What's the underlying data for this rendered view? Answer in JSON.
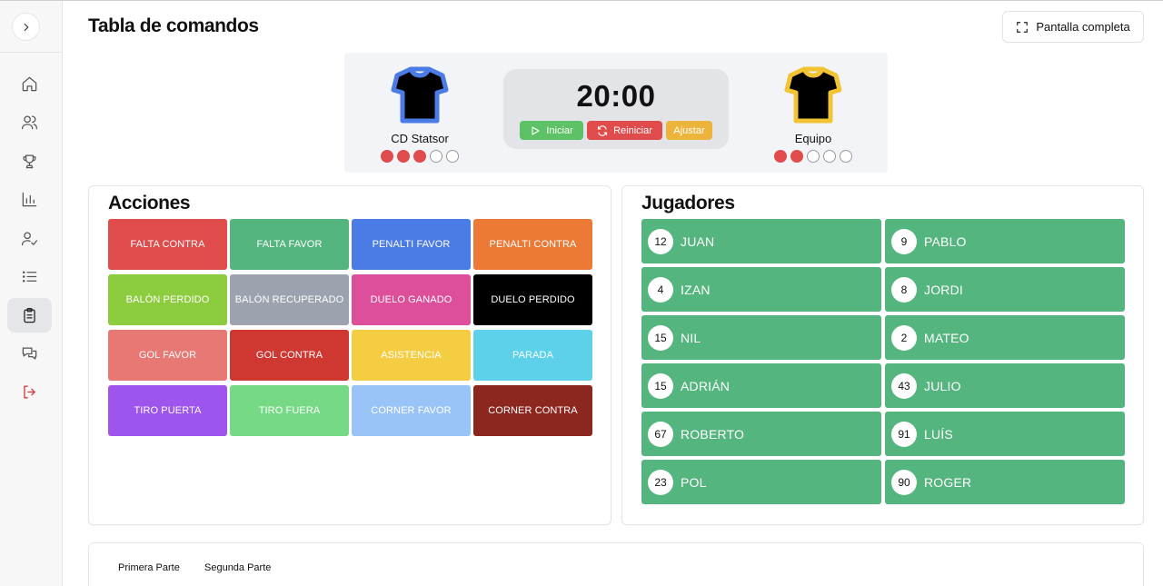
{
  "header": {
    "title": "Tabla de comandos",
    "fullscreen_label": "Pantalla completa"
  },
  "sidebar": {
    "items": [
      {
        "icon": "home-icon"
      },
      {
        "icon": "users-icon"
      },
      {
        "icon": "trophy-icon"
      },
      {
        "icon": "bar-chart-icon"
      },
      {
        "icon": "user-check-icon"
      },
      {
        "icon": "list-icon"
      },
      {
        "icon": "clipboard-icon",
        "active": true
      },
      {
        "icon": "messages-icon"
      },
      {
        "icon": "logout-icon"
      }
    ]
  },
  "scoreboard": {
    "home": {
      "name": "CD Statsor",
      "shirt_color": "#4b7be5",
      "fouls": 3,
      "foul_max": 5
    },
    "away": {
      "name": "Equipo",
      "shirt_color": "#f2c333",
      "fouls": 2,
      "foul_max": 5
    },
    "time": "20:00",
    "buttons": {
      "start": "Iniciar",
      "reset": "Reiniciar",
      "adjust": "Ajustar"
    }
  },
  "actions": {
    "title": "Acciones",
    "items": [
      {
        "label": "FALTA CONTRA",
        "color": "#e04b4b"
      },
      {
        "label": "FALTA FAVOR",
        "color": "#55b57f"
      },
      {
        "label": "PENALTI FAVOR",
        "color": "#4b7be5"
      },
      {
        "label": "PENALTI CONTRA",
        "color": "#ec7a36"
      },
      {
        "label": "BALÓN PERDIDO",
        "color": "#8dcb3f"
      },
      {
        "label": "BALÓN RECUPERADO",
        "color": "#9ca3af"
      },
      {
        "label": "DUELO GANADO",
        "color": "#dd4f9a"
      },
      {
        "label": "DUELO PERDIDO",
        "color": "#000000"
      },
      {
        "label": "GOL FAVOR",
        "color": "#e87873"
      },
      {
        "label": "GOL CONTRA",
        "color": "#cf3731"
      },
      {
        "label": "ASISTENCIA",
        "color": "#f4cd43"
      },
      {
        "label": "PARADA",
        "color": "#5dd0ea"
      },
      {
        "label": "TIRO PUERTA",
        "color": "#9d55ee"
      },
      {
        "label": "TIRO FUERA",
        "color": "#76d985"
      },
      {
        "label": "CORNER FAVOR",
        "color": "#99c4f7"
      },
      {
        "label": "CORNER CONTRA",
        "color": "#8c2720"
      }
    ]
  },
  "players": {
    "title": "Jugadores",
    "items": [
      {
        "number": "12",
        "name": "JUAN"
      },
      {
        "number": "9",
        "name": "PABLO"
      },
      {
        "number": "4",
        "name": "IZAN"
      },
      {
        "number": "8",
        "name": "JORDI"
      },
      {
        "number": "15",
        "name": "NIL"
      },
      {
        "number": "2",
        "name": "MATEO"
      },
      {
        "number": "15",
        "name": "ADRIÁN"
      },
      {
        "number": "43",
        "name": "JULIO"
      },
      {
        "number": "67",
        "name": "ROBERTO"
      },
      {
        "number": "91",
        "name": "LUÍS"
      },
      {
        "number": "23",
        "name": "POL"
      },
      {
        "number": "90",
        "name": "ROGER"
      }
    ]
  },
  "periods": {
    "first": "Primera Parte",
    "second": "Segunda Parte"
  }
}
